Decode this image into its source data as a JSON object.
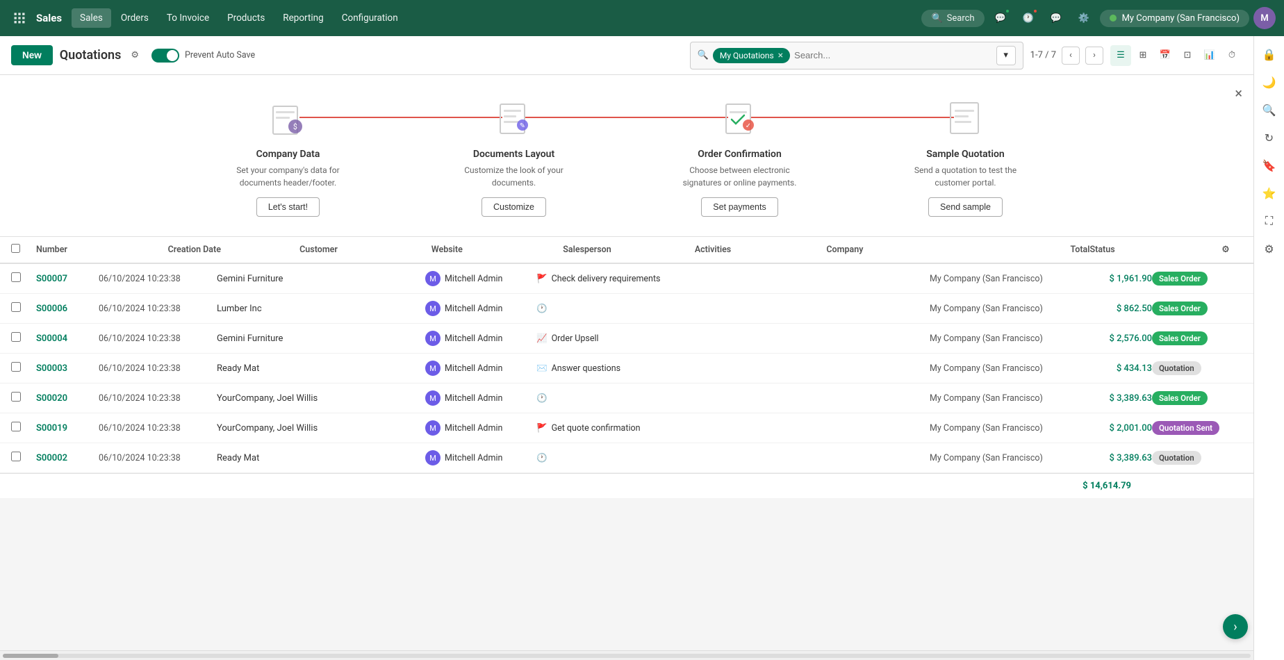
{
  "topnav": {
    "app_name": "Sales",
    "menu_items": [
      {
        "label": "Sales",
        "active": true
      },
      {
        "label": "Orders"
      },
      {
        "label": "To Invoice"
      },
      {
        "label": "Products"
      },
      {
        "label": "Reporting"
      },
      {
        "label": "Configuration"
      }
    ],
    "search_placeholder": "Search",
    "company": "My Company (San Francisco)",
    "avatar_initials": "M"
  },
  "toolbar": {
    "new_label": "New",
    "page_title": "Quotations",
    "toggle_label": "Prevent Auto Save",
    "filter_tag": "My Quotations",
    "search_placeholder": "Search...",
    "pager": "1-7 / 7"
  },
  "onboarding": {
    "close_label": "×",
    "steps": [
      {
        "title": "Company Data",
        "description": "Set your company's data for documents header/footer.",
        "button_label": "Let's start!"
      },
      {
        "title": "Documents Layout",
        "description": "Customize the look of your documents.",
        "button_label": "Customize"
      },
      {
        "title": "Order Confirmation",
        "description": "Choose between electronic signatures or online payments.",
        "button_label": "Set payments"
      },
      {
        "title": "Sample Quotation",
        "description": "Send a quotation to test the customer portal.",
        "button_label": "Send sample"
      }
    ]
  },
  "table": {
    "columns": [
      "Number",
      "Creation Date",
      "Customer",
      "Website",
      "Salesperson",
      "Activities",
      "Company",
      "Total",
      "Status"
    ],
    "rows": [
      {
        "number": "S00007",
        "date": "06/10/2024 10:23:38",
        "customer": "Gemini Furniture",
        "website": "",
        "salesperson": "Mitchell Admin",
        "activity": "Check delivery requirements",
        "activity_icon": "🚩",
        "company": "My Company (San Francisco)",
        "total": "$ 1,961.90",
        "status": "Sales Order",
        "status_type": "sales-order"
      },
      {
        "number": "S00006",
        "date": "06/10/2024 10:23:38",
        "customer": "Lumber Inc",
        "website": "",
        "salesperson": "Mitchell Admin",
        "activity": "",
        "activity_icon": "🕐",
        "company": "My Company (San Francisco)",
        "total": "$ 862.50",
        "status": "Sales Order",
        "status_type": "sales-order"
      },
      {
        "number": "S00004",
        "date": "06/10/2024 10:23:38",
        "customer": "Gemini Furniture",
        "website": "",
        "salesperson": "Mitchell Admin",
        "activity": "Order Upsell",
        "activity_icon": "📈",
        "company": "My Company (San Francisco)",
        "total": "$ 2,576.00",
        "status": "Sales Order",
        "status_type": "sales-order"
      },
      {
        "number": "S00003",
        "date": "06/10/2024 10:23:38",
        "customer": "Ready Mat",
        "website": "",
        "salesperson": "Mitchell Admin",
        "activity": "Answer questions",
        "activity_icon": "✉️",
        "company": "My Company (San Francisco)",
        "total": "$ 434.13",
        "status": "Quotation",
        "status_type": "quotation"
      },
      {
        "number": "S00020",
        "date": "06/10/2024 10:23:38",
        "customer": "YourCompany, Joel Willis",
        "website": "",
        "salesperson": "Mitchell Admin",
        "activity": "",
        "activity_icon": "🕐",
        "company": "My Company (San Francisco)",
        "total": "$ 3,389.63",
        "status": "Sales Order",
        "status_type": "sales-order"
      },
      {
        "number": "S00019",
        "date": "06/10/2024 10:23:38",
        "customer": "YourCompany, Joel Willis",
        "website": "",
        "salesperson": "Mitchell Admin",
        "activity": "Get quote confirmation",
        "activity_icon": "🚩",
        "company": "My Company (San Francisco)",
        "total": "$ 2,001.00",
        "status": "Quotation Sent",
        "status_type": "quotation-sent"
      },
      {
        "number": "S00002",
        "date": "06/10/2024 10:23:38",
        "customer": "Ready Mat",
        "website": "",
        "salesperson": "Mitchell Admin",
        "activity": "",
        "activity_icon": "🕐",
        "company": "My Company (San Francisco)",
        "total": "$ 3,389.63",
        "status": "Quotation",
        "status_type": "quotation"
      }
    ],
    "grand_total": "$ 14,614.79"
  },
  "sidebar_icons": [
    {
      "name": "lock-icon",
      "symbol": "🔒"
    },
    {
      "name": "moon-icon",
      "symbol": "🌙"
    },
    {
      "name": "zoom-icon",
      "symbol": "🔍"
    },
    {
      "name": "refresh-icon",
      "symbol": "↻"
    },
    {
      "name": "bookmark-icon",
      "symbol": "🔖"
    },
    {
      "name": "star-icon",
      "symbol": "⭐"
    },
    {
      "name": "expand-icon",
      "symbol": "⛶"
    },
    {
      "name": "settings2-icon",
      "symbol": "⚙"
    }
  ]
}
